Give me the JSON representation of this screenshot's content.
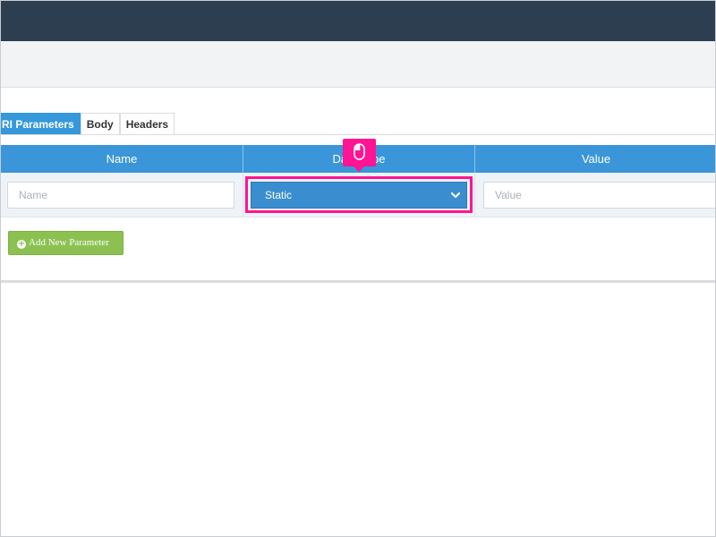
{
  "tabs": [
    {
      "label": "RI Parameters",
      "active": true
    },
    {
      "label": "Body",
      "active": false
    },
    {
      "label": "Headers",
      "active": false
    }
  ],
  "table": {
    "headers": [
      "Name",
      "Data Type",
      "Value"
    ],
    "row": {
      "name_placeholder": "Name",
      "name_value": "",
      "data_type": "Static",
      "value_placeholder": "Value",
      "value_value": ""
    }
  },
  "buttons": {
    "add_parameter": "Add New Parameter",
    "add_icon": "+"
  },
  "icons": {
    "cursor_hint": "mouse-icon",
    "select_arrow": "chevron-down-icon",
    "add": "plus-circle-icon"
  },
  "colors": {
    "header_bar": "#2c3e50",
    "accent_blue": "#3a96d8",
    "highlight": "#ff1493",
    "add_button": "#8cc152"
  }
}
